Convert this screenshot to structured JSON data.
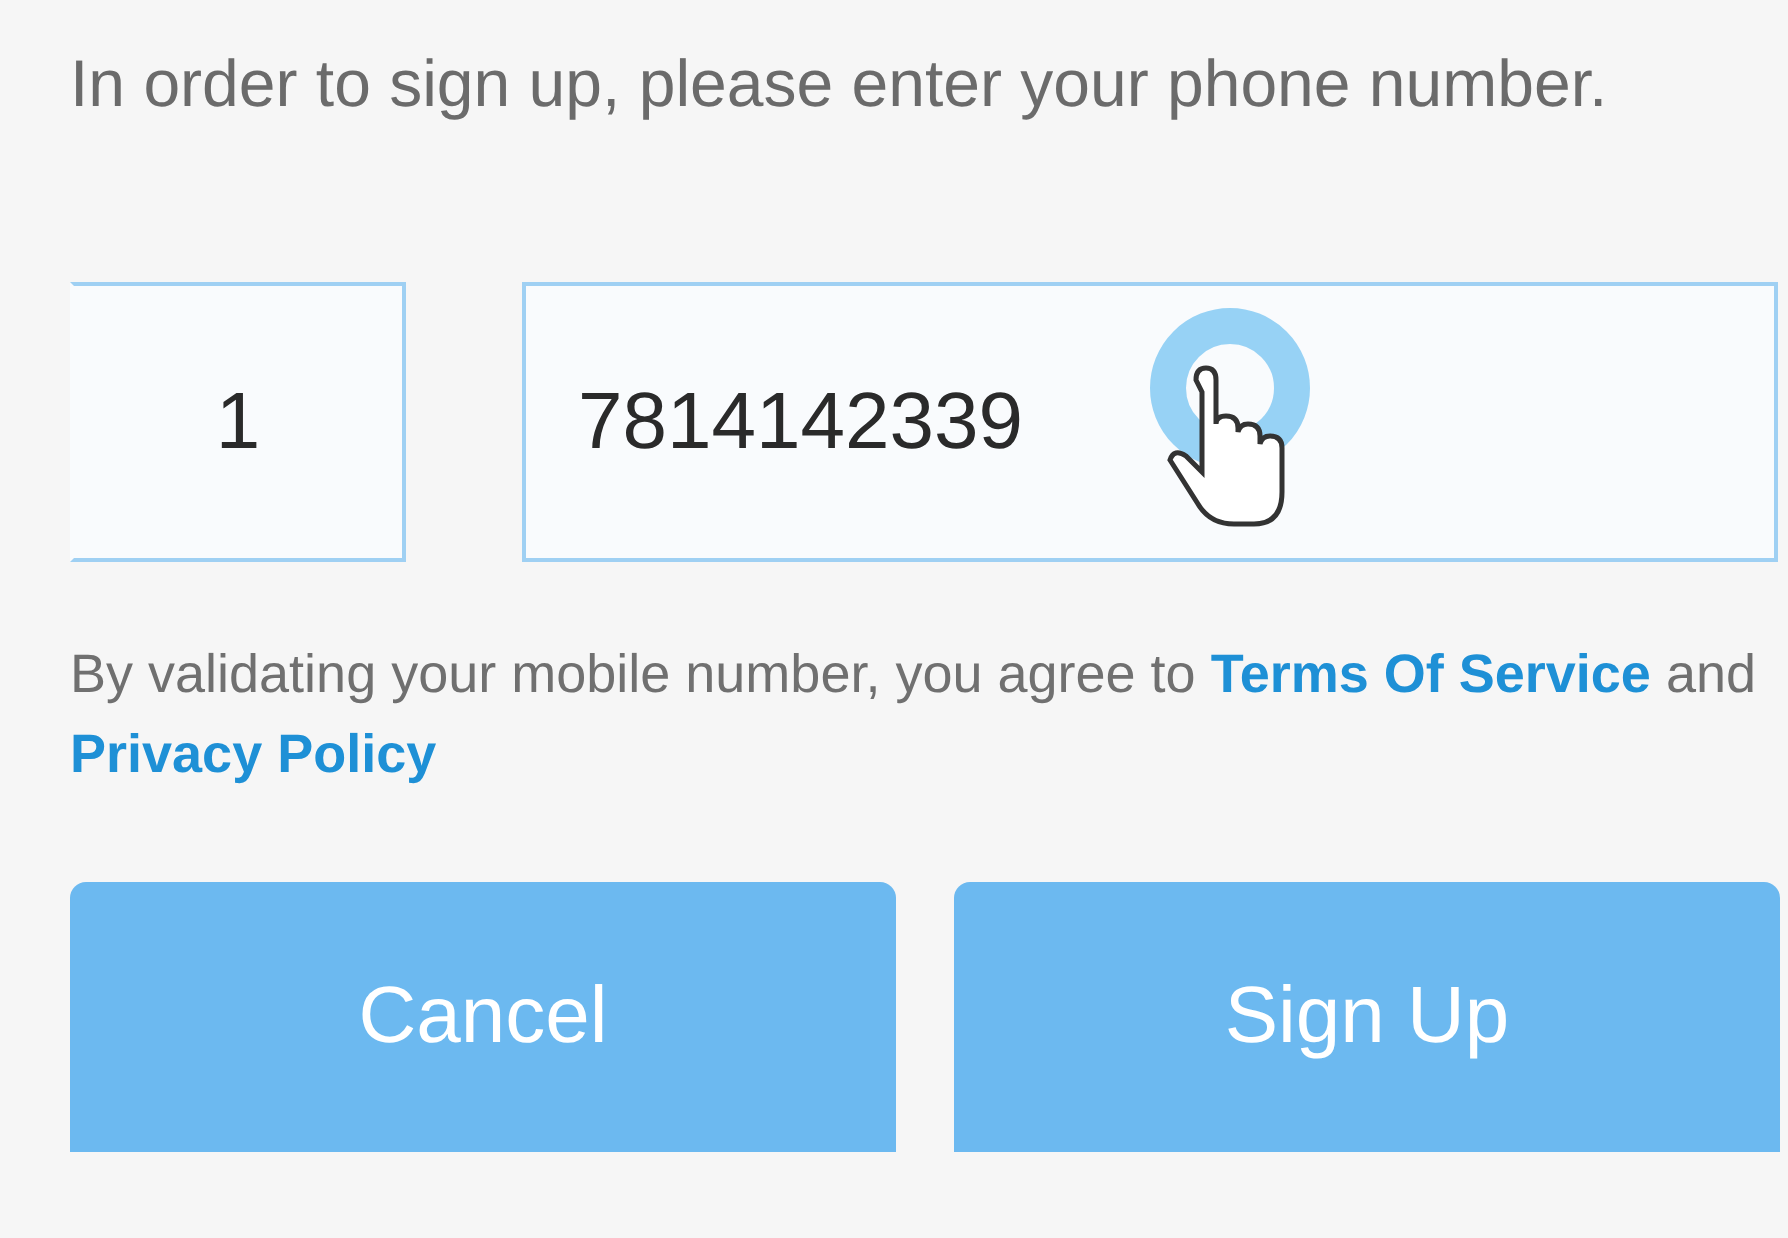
{
  "instruction": "In order to sign up, please enter your phone number.",
  "country_code": {
    "value": "1"
  },
  "phone": {
    "value": "7814142339"
  },
  "terms": [
    {
      "kind": "text",
      "text": "By validating your mobile number, you agree to "
    },
    {
      "kind": "link",
      "text": "Terms Of Service"
    },
    {
      "kind": "text",
      "text": " and "
    },
    {
      "kind": "link",
      "text": "Privacy Policy"
    }
  ],
  "buttons": [
    {
      "label": "Cancel"
    },
    {
      "label": "Sign Up"
    }
  ]
}
